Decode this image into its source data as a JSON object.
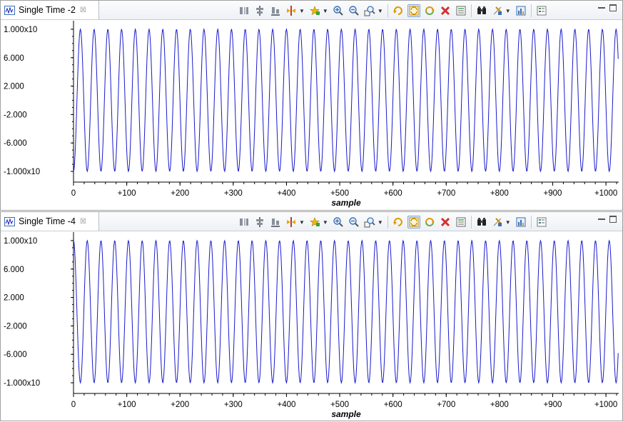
{
  "views": [
    {
      "tab_title": "Single Time -2",
      "close_glyph": "☒",
      "series_color": "#1a1acc",
      "chart_data": {
        "type": "line",
        "xlabel": "sample",
        "ylabel": "",
        "xlim": [
          0,
          1024
        ],
        "ylim": [
          -11.2,
          11.2
        ],
        "x_ticks": [
          0,
          100,
          200,
          300,
          400,
          500,
          600,
          700,
          800,
          900,
          1000
        ],
        "x_tick_labels": [
          "0",
          "+100",
          "+200",
          "+300",
          "+400",
          "+500",
          "+600",
          "+700",
          "+800",
          "+900",
          "+1000"
        ],
        "y_ticks": [
          10,
          6,
          2,
          -2,
          -6,
          -10
        ],
        "y_tick_labels": [
          "1.000x10",
          "6.000",
          "2.000",
          "-2.000",
          "-6.000",
          "-1.000x10"
        ],
        "series": [
          {
            "amplitude": 10,
            "period_samples": 25.8,
            "phase_deg": -90,
            "n_samples": 1024,
            "x_start": 0,
            "x_step": 1
          }
        ],
        "grid": false
      }
    },
    {
      "tab_title": "Single Time -4",
      "close_glyph": "☒",
      "series_color": "#1a1acc",
      "chart_data": {
        "type": "line",
        "xlabel": "sample",
        "ylabel": "",
        "xlim": [
          0,
          1024
        ],
        "ylim": [
          -11.2,
          11.2
        ],
        "x_ticks": [
          0,
          100,
          200,
          300,
          400,
          500,
          600,
          700,
          800,
          900,
          1000
        ],
        "x_tick_labels": [
          "0",
          "+100",
          "+200",
          "+300",
          "+400",
          "+500",
          "+600",
          "+700",
          "+800",
          "+900",
          "+1000"
        ],
        "y_ticks": [
          10,
          6,
          2,
          -2,
          -6,
          -10
        ],
        "y_tick_labels": [
          "1.000x10",
          "6.000",
          "2.000",
          "-2.000",
          "-6.000",
          "-1.000x10"
        ],
        "series": [
          {
            "amplitude": 10,
            "period_samples": 25.8,
            "phase_deg": 90,
            "n_samples": 1024,
            "x_start": 0,
            "x_step": 1
          }
        ],
        "grid": false
      }
    }
  ],
  "toolbar_icons": [
    "column-layout-icon",
    "align-center-icon",
    "align-bottom-icon",
    "cursor-marker-icon",
    "dropdown",
    "add-item-icon",
    "dropdown",
    "zoom-in-icon",
    "zoom-out-icon",
    "zoom-fit-icon",
    "dropdown",
    "separator",
    "refresh-icon",
    "sync-icon",
    "rotate-icon",
    "delete-icon",
    "list-icon",
    "separator",
    "binoculars-icon",
    "pin-icon",
    "dropdown",
    "chart-properties-icon",
    "separator",
    "legend-icon"
  ],
  "toolbar_selected": [
    "sync-icon"
  ]
}
